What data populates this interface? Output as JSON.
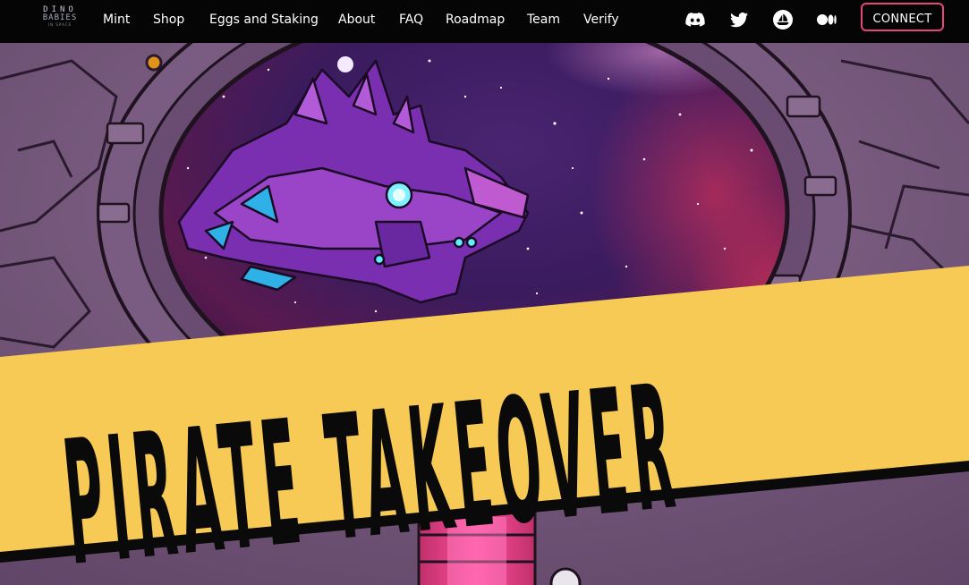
{
  "logo": {
    "line1": "DINO",
    "line2": "BABIES",
    "line3": "IN SPACE"
  },
  "nav": {
    "items": [
      {
        "label": "Mint"
      },
      {
        "label": "Shop"
      },
      {
        "label": "Eggs and Staking"
      },
      {
        "label": "About"
      },
      {
        "label": "FAQ"
      },
      {
        "label": "Roadmap"
      },
      {
        "label": "Team"
      },
      {
        "label": "Verify"
      }
    ],
    "socials": [
      "discord-icon",
      "twitter-icon",
      "opensea-icon",
      "medium-icon"
    ],
    "connect_label": "CONNECT"
  },
  "hero": {
    "banner_text": "PIRATE TAKEOVER",
    "colors": {
      "banner": "#f7c955",
      "space": "#3a1b5e",
      "ship": "#7a2fb0",
      "accent": "#e8457c"
    }
  }
}
